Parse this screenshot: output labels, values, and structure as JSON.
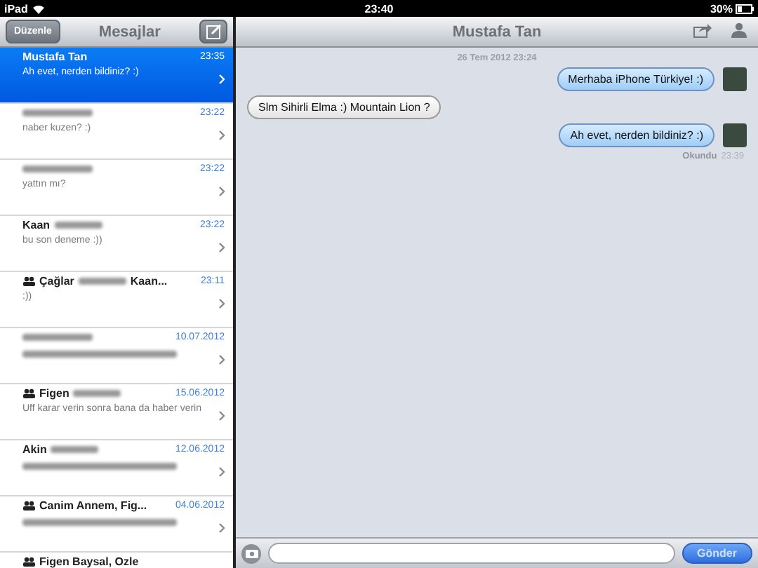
{
  "status_bar": {
    "device": "iPad",
    "time": "23:40",
    "battery": "30%"
  },
  "sidebar": {
    "title": "Mesajlar",
    "edit_button": "Düzenle",
    "conversations": [
      {
        "name": "Mustafa Tan",
        "preview": "Ah evet, nerden bildiniz? :)",
        "time": "23:35",
        "selected": true
      },
      {
        "name_redacted": true,
        "preview": "naber kuzen? :)",
        "time": "23:22",
        "selected": false
      },
      {
        "name_redacted": true,
        "preview": "yattın mı?",
        "time": "23:22",
        "selected": false
      },
      {
        "name": "Kaan",
        "name_redacted": true,
        "preview": "bu son deneme :))",
        "time": "23:22",
        "selected": false
      },
      {
        "group": true,
        "name": "Çağlar",
        "name_redacted": true,
        "name_suffix": "Kaan...",
        "preview": ":))",
        "time": "23:11",
        "selected": false
      },
      {
        "name_redacted": true,
        "preview_redacted": true,
        "time": "10.07.2012",
        "selected": false
      },
      {
        "group": true,
        "name": "Figen",
        "name_redacted": true,
        "preview": "Uff karar verin sonra bana da haber verin",
        "time": "15.06.2012",
        "selected": false
      },
      {
        "name": "Akin",
        "name_redacted": true,
        "preview_redacted": true,
        "time": "12.06.2012",
        "selected": false
      },
      {
        "group": true,
        "name": "Canim Annem, Fig...",
        "preview_redacted": true,
        "time": "04.06.2012",
        "selected": false
      },
      {
        "group": true,
        "name": "Figen Baysal, Ozle",
        "selected": false
      }
    ]
  },
  "chat": {
    "title": "Mustafa Tan",
    "date_stamp": "26 Tem 2012 23:24",
    "messages": [
      {
        "kind": "outgoing",
        "text": "Merhaba iPhone Türkiye! :)"
      },
      {
        "kind": "incoming",
        "text": "Slm Sihirli Elma :) Mountain Lion ?"
      },
      {
        "kind": "outgoing",
        "text": "Ah evet, nerden bildiniz? :)"
      }
    ],
    "receipt": {
      "label": "Okundu",
      "time": "23:39"
    },
    "send_button": "Gönder"
  }
}
